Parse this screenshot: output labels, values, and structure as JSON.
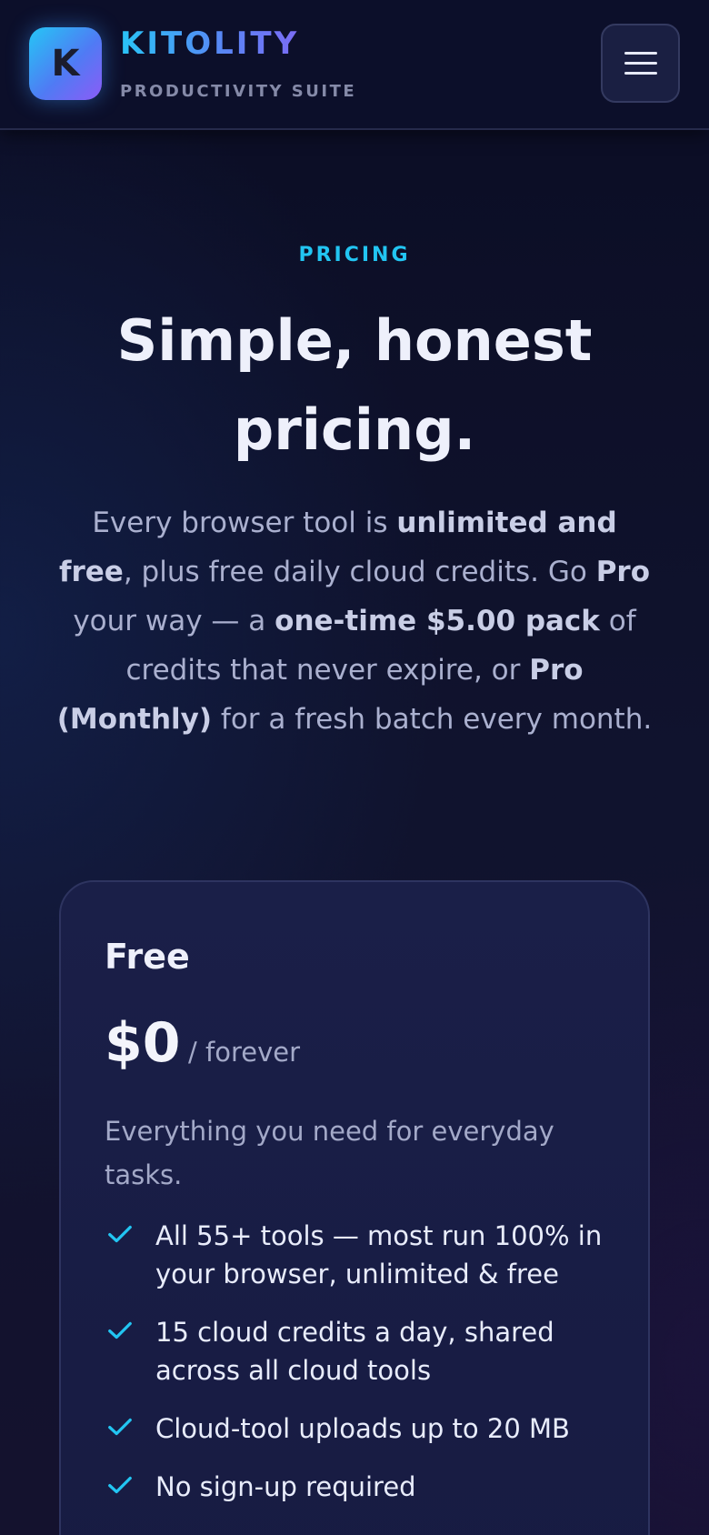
{
  "header": {
    "logo_letter": "K",
    "brand_name": "KITOLITY",
    "brand_tagline": "PRODUCTIVITY SUITE",
    "menu_icon": "hamburger-menu-icon"
  },
  "hero": {
    "eyebrow": "PRICING",
    "title": "Simple, honest pricing.",
    "lede": {
      "p1": "Every browser tool is ",
      "b1": "unlimited and free",
      "p2": ", plus free daily cloud credits. Go ",
      "b2": "Pro",
      "p3": " your way — a ",
      "b3": "one-time $5.00 pack",
      "p4": " of credits that never expire, or ",
      "b4": "Pro (Monthly)",
      "p5": " for a fresh batch every month."
    }
  },
  "plans": [
    {
      "name": "Free",
      "price": "$0",
      "price_suffix": "/ forever",
      "description": "Everything you need for everyday tasks.",
      "features": [
        "All 55+ tools — most run 100% in your browser, unlimited & free",
        "15 cloud credits a day, shared across all cloud tools",
        "Cloud-tool uploads up to 20 MB",
        "No sign-up required"
      ]
    }
  ],
  "colors": {
    "accent": "#22c5f2",
    "background": "#10132e",
    "card": "#1a1f48"
  }
}
